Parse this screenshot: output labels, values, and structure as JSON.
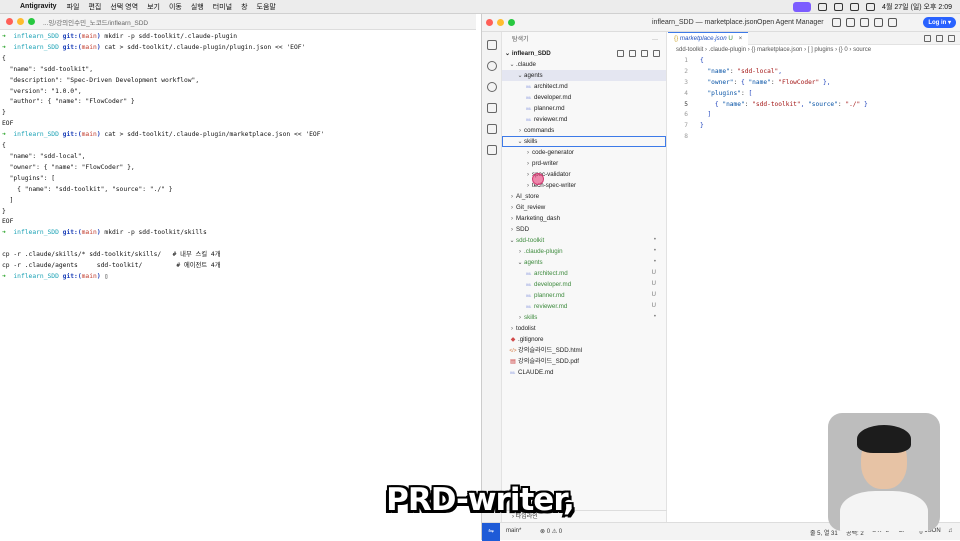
{
  "menubar": {
    "app": "Antigravity",
    "items": [
      "파일",
      "편집",
      "선택 영역",
      "보기",
      "이동",
      "실행",
      "터미널",
      "창",
      "도움말"
    ],
    "clock": "4월 27일 (일) 오후 2:09"
  },
  "terminal": {
    "title": "...잉/강의인수민_노코드/inflearn_SDD",
    "lines": [
      {
        "type": "prompt",
        "cmd": "mkdir -p sdd-toolkit/.claude-plugin"
      },
      {
        "type": "prompt",
        "cmd": "cat > sdd-toolkit/.claude-plugin/plugin.json << 'EOF'"
      },
      {
        "type": "out",
        "text": "{"
      },
      {
        "type": "out",
        "text": "  \"name\": \"sdd-toolkit\","
      },
      {
        "type": "out",
        "text": "  \"description\": \"Spec-Driven Development workflow\","
      },
      {
        "type": "out",
        "text": "  \"version\": \"1.0.0\","
      },
      {
        "type": "out",
        "text": "  \"author\": { \"name\": \"FlowCoder\" }"
      },
      {
        "type": "out",
        "text": "}"
      },
      {
        "type": "out",
        "text": "EOF"
      },
      {
        "type": "prompt",
        "cmd": "cat > sdd-toolkit/.claude-plugin/marketplace.json << 'EOF'"
      },
      {
        "type": "out",
        "text": "{"
      },
      {
        "type": "out",
        "text": "  \"name\": \"sdd-local\","
      },
      {
        "type": "out",
        "text": "  \"owner\": { \"name\": \"FlowCoder\" },"
      },
      {
        "type": "out",
        "text": "  \"plugins\": ["
      },
      {
        "type": "out",
        "text": "    { \"name\": \"sdd-toolkit\", \"source\": \"./\" }"
      },
      {
        "type": "out",
        "text": "  ]"
      },
      {
        "type": "out",
        "text": "}"
      },
      {
        "type": "out",
        "text": "EOF"
      },
      {
        "type": "prompt",
        "cmd": "mkdir -p sdd-toolkit/skills"
      },
      {
        "type": "out",
        "text": ""
      },
      {
        "type": "out",
        "text": "cp -r .claude/skills/* sdd-toolkit/skills/   # 내부 스킬 4개"
      },
      {
        "type": "out",
        "text": "cp -r .claude/agents     sdd-toolkit/         # 에이전트 4개"
      },
      {
        "type": "prompt",
        "cmd": "▯"
      }
    ],
    "prompt_dir": "inflearn_SDD",
    "prompt_git": "git:(",
    "prompt_branch": "main",
    "prompt_git_close": ")"
  },
  "vscode": {
    "window_title": "inflearn_SDD — marketplace.json",
    "agent_manager": "Open Agent Manager",
    "login": "Log in ▾",
    "explorer_label": "탐색기",
    "root": "inflearn_SDD",
    "tree": [
      {
        "depth": 1,
        "kind": "folder",
        "open": true,
        "label": ".claude"
      },
      {
        "depth": 2,
        "kind": "folder",
        "open": true,
        "label": "agents",
        "sel": true
      },
      {
        "depth": 3,
        "kind": "md",
        "label": "architect.md"
      },
      {
        "depth": 3,
        "kind": "md",
        "label": "developer.md"
      },
      {
        "depth": 3,
        "kind": "md",
        "label": "planner.md"
      },
      {
        "depth": 3,
        "kind": "md",
        "label": "reviewer.md"
      },
      {
        "depth": 2,
        "kind": "folder",
        "open": false,
        "label": "commands"
      },
      {
        "depth": 2,
        "kind": "folder",
        "open": true,
        "label": "skills",
        "focus": true
      },
      {
        "depth": 3,
        "kind": "folder",
        "open": false,
        "label": "code-generator"
      },
      {
        "depth": 3,
        "kind": "folder",
        "open": false,
        "label": "prd-writer"
      },
      {
        "depth": 3,
        "kind": "folder",
        "open": false,
        "label": "spec-validator"
      },
      {
        "depth": 3,
        "kind": "folder",
        "open": false,
        "label": "tech-spec-writer"
      },
      {
        "depth": 1,
        "kind": "folder",
        "open": false,
        "label": "AI_store"
      },
      {
        "depth": 1,
        "kind": "folder",
        "open": false,
        "label": "Git_review"
      },
      {
        "depth": 1,
        "kind": "folder",
        "open": false,
        "label": "Marketing_dash"
      },
      {
        "depth": 1,
        "kind": "folder",
        "open": false,
        "label": "SDD"
      },
      {
        "depth": 1,
        "kind": "folder",
        "open": true,
        "label": "sdd-toolkit",
        "green": true,
        "badge": "•"
      },
      {
        "depth": 2,
        "kind": "folder",
        "open": false,
        "label": ".claude-plugin",
        "green": true,
        "badge": "•"
      },
      {
        "depth": 2,
        "kind": "folder",
        "open": true,
        "label": "agents",
        "green": true,
        "badge": "•"
      },
      {
        "depth": 3,
        "kind": "md",
        "label": "architect.md",
        "green": true,
        "badge": "U"
      },
      {
        "depth": 3,
        "kind": "md",
        "label": "developer.md",
        "green": true,
        "badge": "U"
      },
      {
        "depth": 3,
        "kind": "md",
        "label": "planner.md",
        "green": true,
        "badge": "U"
      },
      {
        "depth": 3,
        "kind": "md",
        "label": "reviewer.md",
        "green": true,
        "badge": "U"
      },
      {
        "depth": 2,
        "kind": "folder",
        "open": false,
        "label": "skills",
        "green": true,
        "badge": "•"
      },
      {
        "depth": 1,
        "kind": "folder",
        "open": false,
        "label": "todolist"
      },
      {
        "depth": 1,
        "kind": "git",
        "label": ".gitignore"
      },
      {
        "depth": 1,
        "kind": "html",
        "label": "강의슬라이드_SDD.html"
      },
      {
        "depth": 1,
        "kind": "pdf",
        "label": "강의슬라이드_SDD.pdf"
      },
      {
        "depth": 1,
        "kind": "md",
        "label": "CLAUDE.md"
      }
    ],
    "timeline": "타임라인",
    "tab": "marketplace.json",
    "tab_badge": "U",
    "breadcrumb": "sdd-toolkit › .claude-plugin › {} marketplace.json › [ ] plugins › {} 0 › source",
    "code": [
      "{",
      "  \"name\": \"sdd-local\",",
      "  \"owner\": { \"name\": \"FlowCoder\" },",
      "  \"plugins\": [",
      "    { \"name\": \"sdd-toolkit\", \"source\": \"./\" }",
      "  ]",
      "}",
      ""
    ],
    "current_line": 5,
    "status": {
      "branch": "main*",
      "problems": "⊗ 0 ⚠ 0",
      "position": "줄 5, 열 31",
      "spaces": "공백: 2",
      "encoding": "UTF-8",
      "eol": "LF",
      "language": "{} JSON"
    }
  },
  "subtitle": "PRD-writer,"
}
